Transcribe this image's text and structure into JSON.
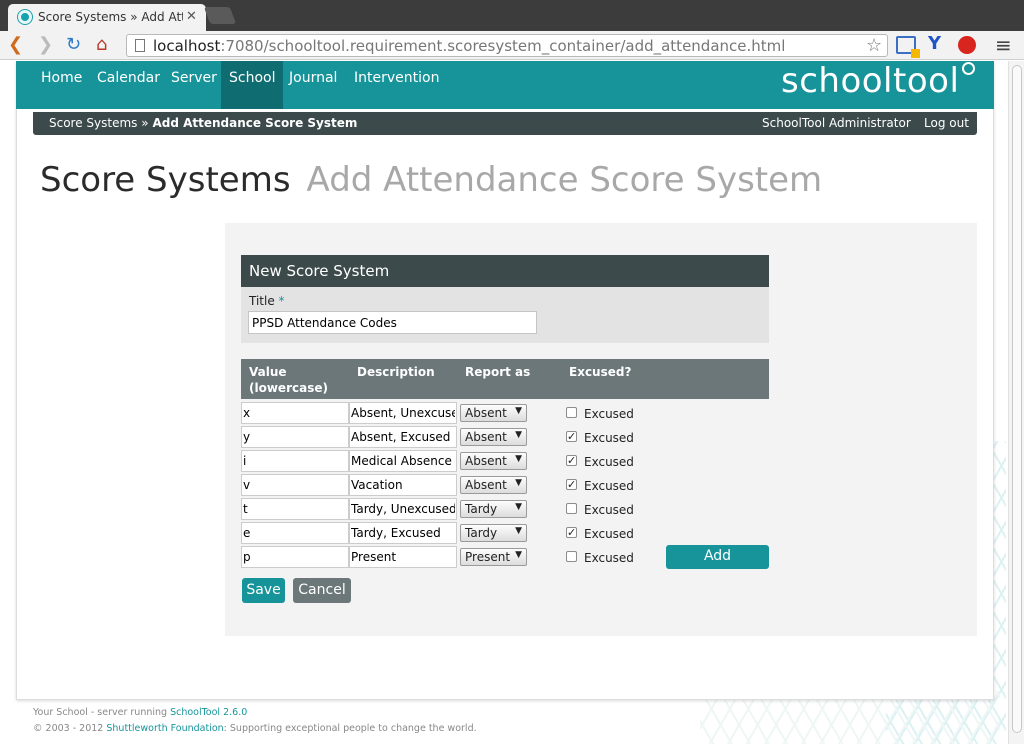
{
  "browser": {
    "tab_title": "Score Systems » Add Atte",
    "url_host": "localhost",
    "url_rest": ":7080/schooltool.requirement.scoresystem_container/add_attendance.html"
  },
  "nav": {
    "items": [
      {
        "label": "Home"
      },
      {
        "label": "Calendar"
      },
      {
        "label": "Server"
      },
      {
        "label": "School",
        "active": true
      },
      {
        "label": "Journal"
      },
      {
        "label": "Intervention"
      }
    ],
    "logo": "schooltool"
  },
  "subbar": {
    "crumb_link": "Score Systems",
    "crumb_sep": "»",
    "crumb_current": "Add Attendance Score System",
    "user": "SchoolTool Administrator",
    "logout": "Log out"
  },
  "heading": {
    "main": "Score Systems",
    "sub": "Add Attendance Score System"
  },
  "form": {
    "fieldset_title": "New Score System",
    "title_label": "Title",
    "required_mark": "*",
    "title_value": "PPSD Attendance Codes",
    "columns": {
      "value": "Value",
      "value_sub": "(lowercase)",
      "description": "Description",
      "report_as": "Report as",
      "excused": "Excused?"
    },
    "rows": [
      {
        "value": "x",
        "description": "Absent, Unexcused",
        "report_as": "Absent",
        "excused": false,
        "excused_label": "Excused"
      },
      {
        "value": "y",
        "description": "Absent, Excused",
        "report_as": "Absent",
        "excused": true,
        "excused_label": "Excused"
      },
      {
        "value": "i",
        "description": "Medical Absence",
        "report_as": "Absent",
        "excused": true,
        "excused_label": "Excused"
      },
      {
        "value": "v",
        "description": "Vacation",
        "report_as": "Absent",
        "excused": true,
        "excused_label": "Excused"
      },
      {
        "value": "t",
        "description": "Tardy, Unexcused",
        "report_as": "Tardy",
        "excused": false,
        "excused_label": "Excused"
      },
      {
        "value": "e",
        "description": "Tardy, Excused",
        "report_as": "Tardy",
        "excused": true,
        "excused_label": "Excused"
      },
      {
        "value": "p",
        "description": "Present",
        "report_as": "Present",
        "excused": false,
        "excused_label": "Excused"
      }
    ],
    "add_label": "Add",
    "save_label": "Save",
    "cancel_label": "Cancel"
  },
  "footer": {
    "line1_prefix": "Your School - server running ",
    "line1_link": "SchoolTool 2.6.0",
    "line2_prefix": "© 2003 - 2012 ",
    "line2_link": "Shuttleworth Foundation",
    "line2_suffix": ": Supporting exceptional people to change the world."
  },
  "colors": {
    "brand": "#17949a",
    "brand_dark": "#0f6d72",
    "bar_dark": "#3d4a4c",
    "grid_head": "#6b7779"
  }
}
